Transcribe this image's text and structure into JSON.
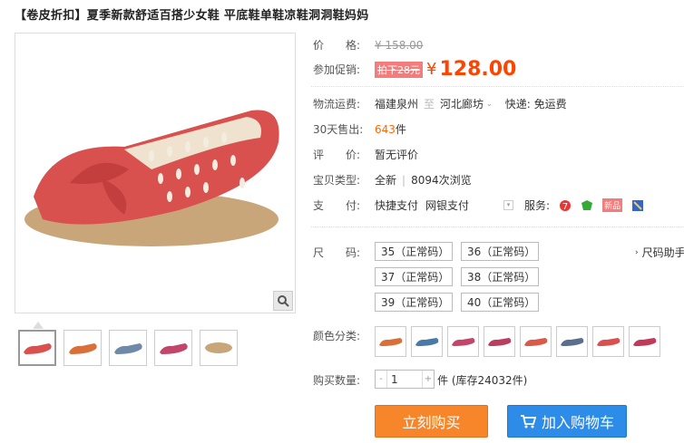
{
  "title": "【卷皮折扣】夏季新款舒适百搭少女鞋 平底鞋单鞋凉鞋洞洞鞋妈妈",
  "price": {
    "label": "价　　格:",
    "value": "¥ 158.00"
  },
  "promo": {
    "label": "参加促销:",
    "badge": "拍下28元",
    "currency": "¥",
    "value": "128.00"
  },
  "shipping": {
    "label": "物流运费:",
    "from": "福建泉州",
    "sep": "至",
    "to": "河北廊坊",
    "fee": "快递: 免运费"
  },
  "sold": {
    "label": "30天售出:",
    "count": "643",
    "unit": "件"
  },
  "rating": {
    "label": "评　　价:",
    "value": "暂无评价"
  },
  "type": {
    "label": "宝贝类型:",
    "condition": "全新",
    "views": "8094次浏览"
  },
  "payment": {
    "label": "支　　付:",
    "m1": "快捷支付",
    "m2": "网银支付",
    "service_label": "服务:",
    "new_badge": "新品"
  },
  "size": {
    "label": "尺　　码:",
    "guide": "尺码助手",
    "options": [
      "35（正常码）",
      "36（正常码）",
      "37（正常码）",
      "38（正常码）",
      "39（正常码）",
      "40（正常码）"
    ]
  },
  "color": {
    "label": "颜色分类:"
  },
  "quantity": {
    "label": "购买数量:",
    "value": "1",
    "stock": "件 (库存24032件)"
  },
  "buttons": {
    "buy": "立刻购买",
    "cart": "加入购物车"
  },
  "colors": {
    "accent": "#ff4400",
    "buy": "#f7862a",
    "cart": "#2d8ce8",
    "shoe": "#d9514f"
  }
}
